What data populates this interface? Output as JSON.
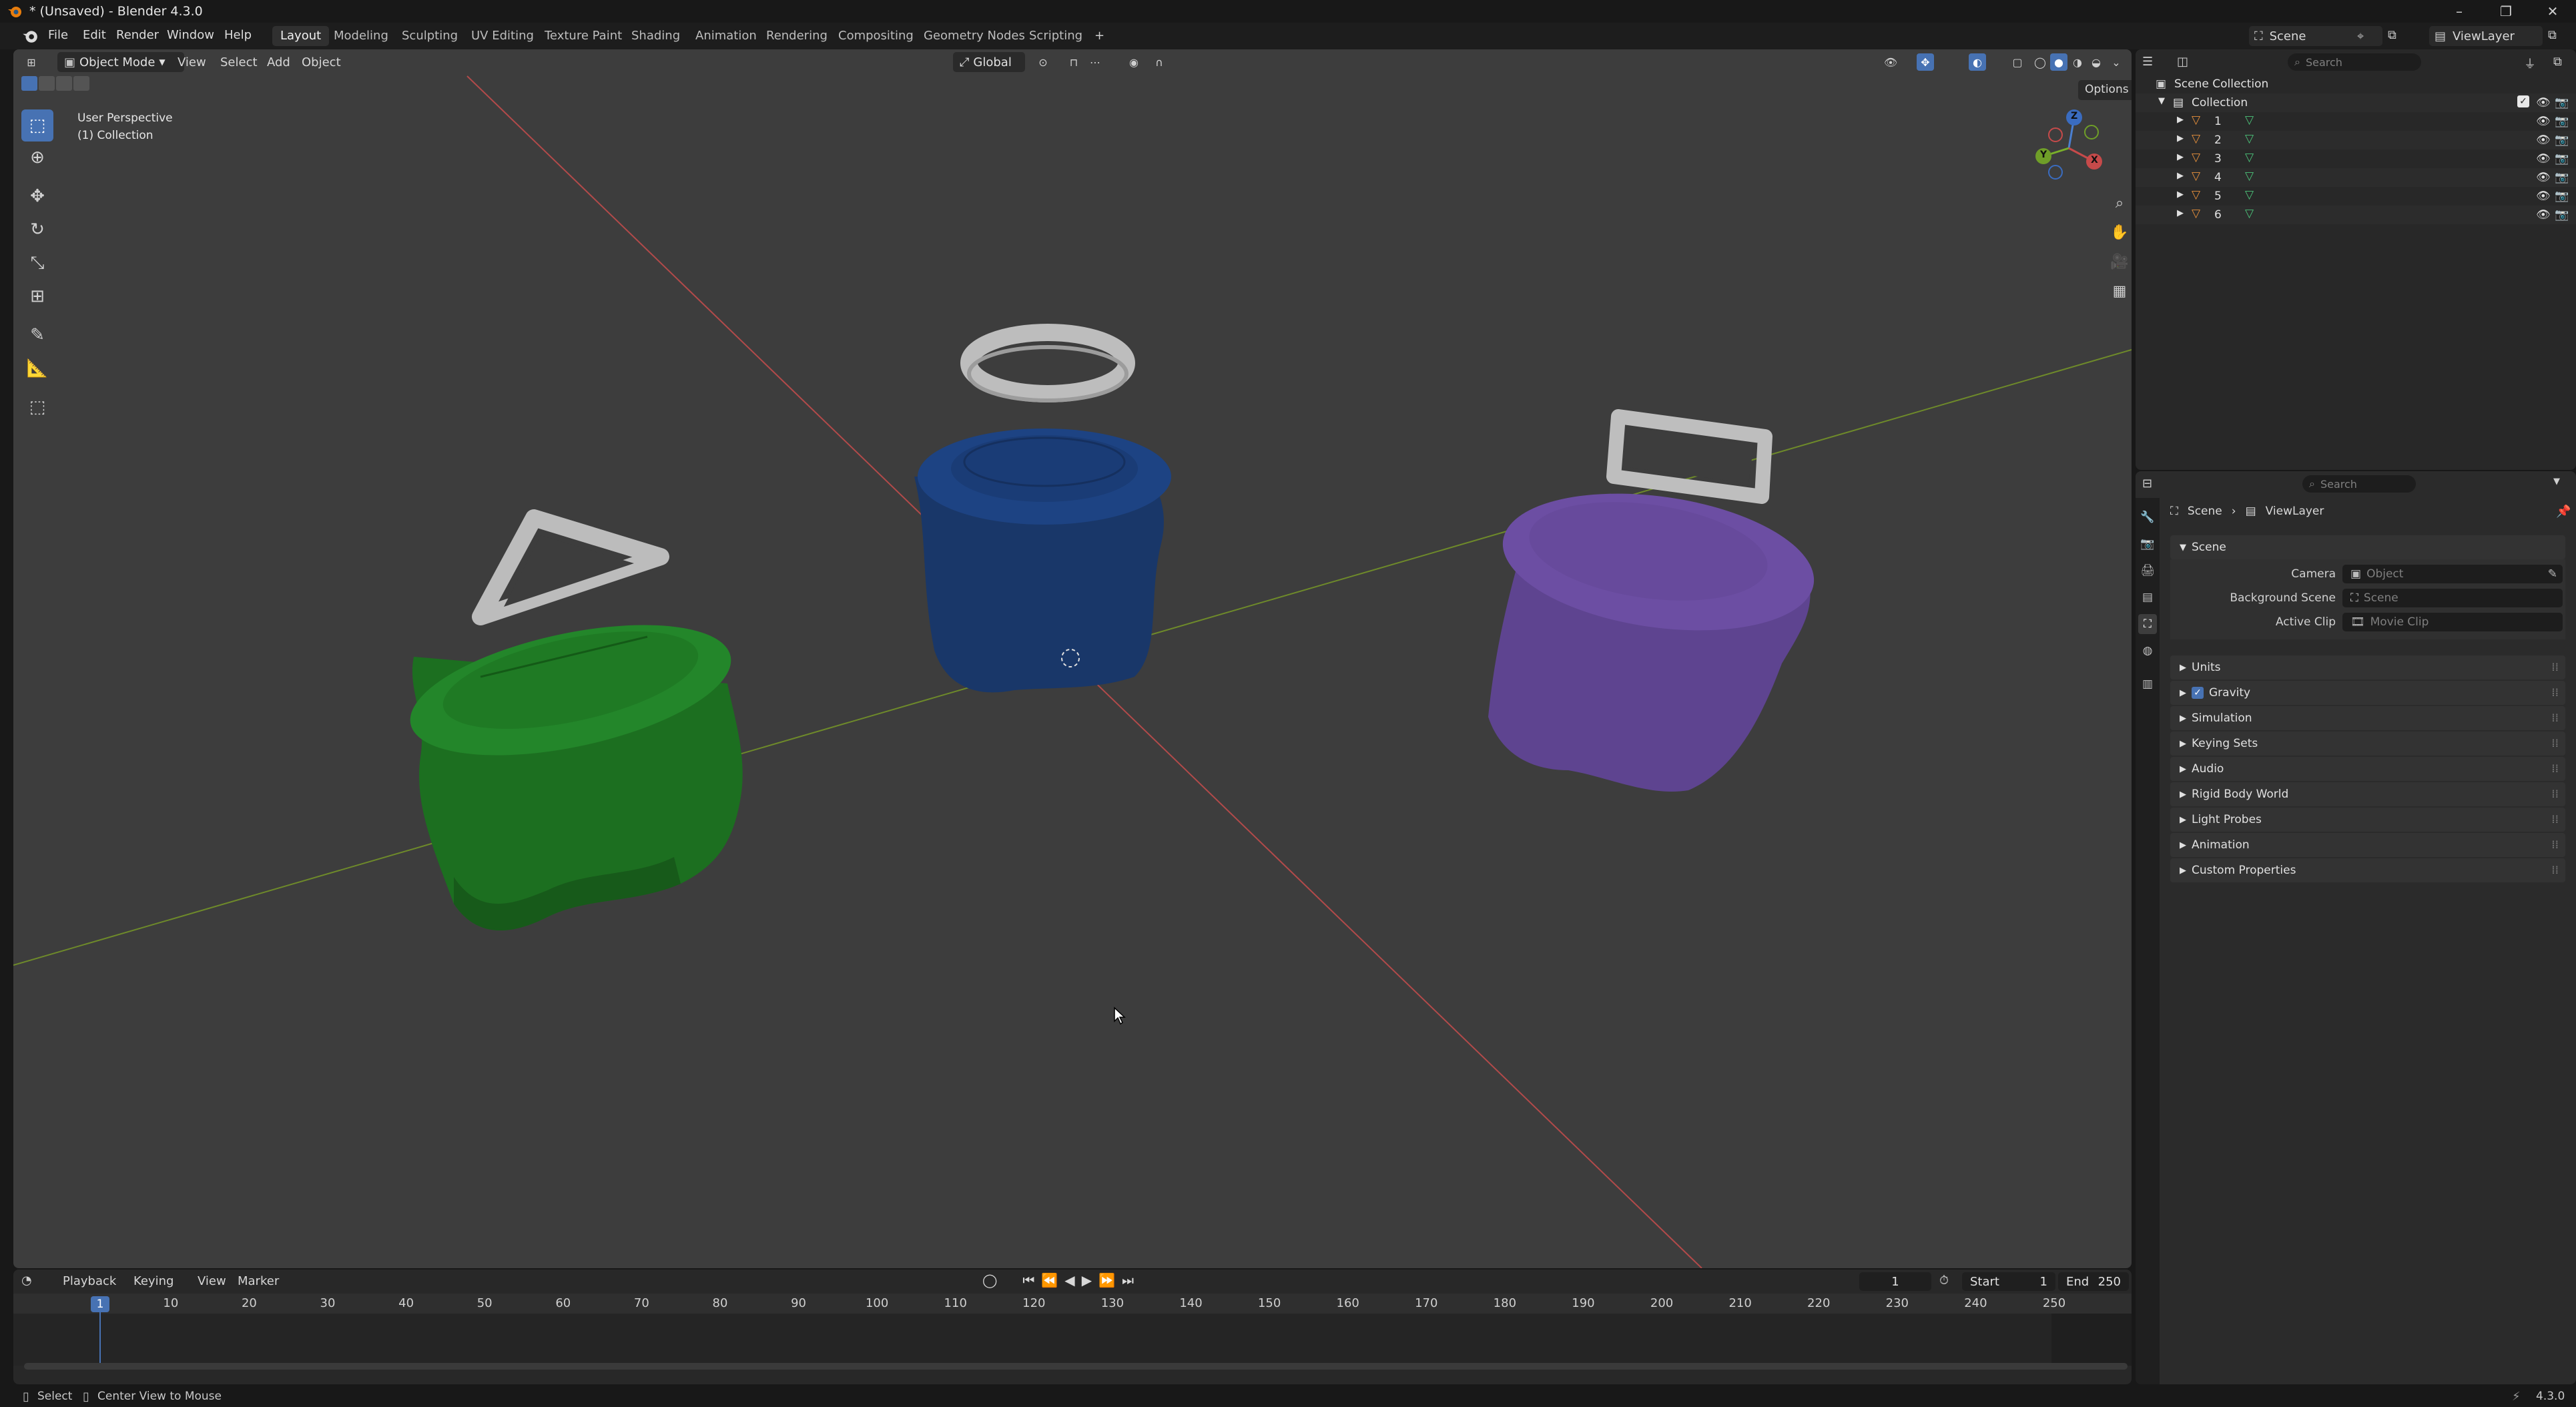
{
  "window": {
    "title": "* (Unsaved) - Blender 4.3.0"
  },
  "menu": {
    "items": [
      "File",
      "Edit",
      "Render",
      "Window",
      "Help"
    ]
  },
  "workspaces": {
    "tabs": [
      "Layout",
      "Modeling",
      "Sculpting",
      "UV Editing",
      "Texture Paint",
      "Shading",
      "Animation",
      "Rendering",
      "Compositing",
      "Geometry Nodes",
      "Scripting"
    ],
    "active": "Layout",
    "add": "+"
  },
  "topright": {
    "scene": "Scene",
    "view_layer": "ViewLayer"
  },
  "viewport": {
    "mode": "Object Mode",
    "menus": [
      "View",
      "Select",
      "Add",
      "Object"
    ],
    "transform_orientation": "Global",
    "options": "Options",
    "info_line1": "User Perspective",
    "info_line2": "(1) Collection",
    "gizmo": {
      "z": "Z",
      "y": "Y",
      "x": "X"
    }
  },
  "outliner": {
    "search_placeholder": "Search",
    "scene_collection": "Scene Collection",
    "collection": "Collection",
    "objects": [
      "1",
      "2",
      "3",
      "4",
      "5",
      "6"
    ]
  },
  "properties": {
    "search_placeholder": "Search",
    "breadcrumb": [
      "Scene",
      "ViewLayer"
    ],
    "scene_panel": "Scene",
    "camera_label": "Camera",
    "camera_value": "Object",
    "background_label": "Background Scene",
    "background_value": "Scene",
    "clip_label": "Active Clip",
    "clip_value": "Movie Clip",
    "panels": [
      "Units",
      "Gravity",
      "Simulation",
      "Keying Sets",
      "Audio",
      "Rigid Body World",
      "Light Probes",
      "Animation",
      "Custom Properties"
    ]
  },
  "timeline": {
    "menus": [
      "Playback",
      "Keying",
      "View",
      "Marker"
    ],
    "current_frame": "1",
    "start_label": "Start",
    "start_value": "1",
    "end_label": "End",
    "end_value": "250",
    "ticks": [
      "1",
      "10",
      "20",
      "30",
      "40",
      "50",
      "60",
      "70",
      "80",
      "90",
      "100",
      "110",
      "120",
      "130",
      "140",
      "150",
      "160",
      "170",
      "180",
      "190",
      "200",
      "210",
      "220",
      "230",
      "240",
      "250"
    ]
  },
  "statusbar": {
    "select": "Select",
    "center_view": "Center View to Mouse",
    "version": "4.3.0"
  },
  "colors": {
    "accent": "#4772b3",
    "green_object": "#1f7a24",
    "blue_object": "#1c3a6e",
    "purple_object": "#6a4b9a",
    "ring_gray": "#b8b8b8",
    "x_axis": "#c44545",
    "y_axis": "#7a9a2a"
  }
}
